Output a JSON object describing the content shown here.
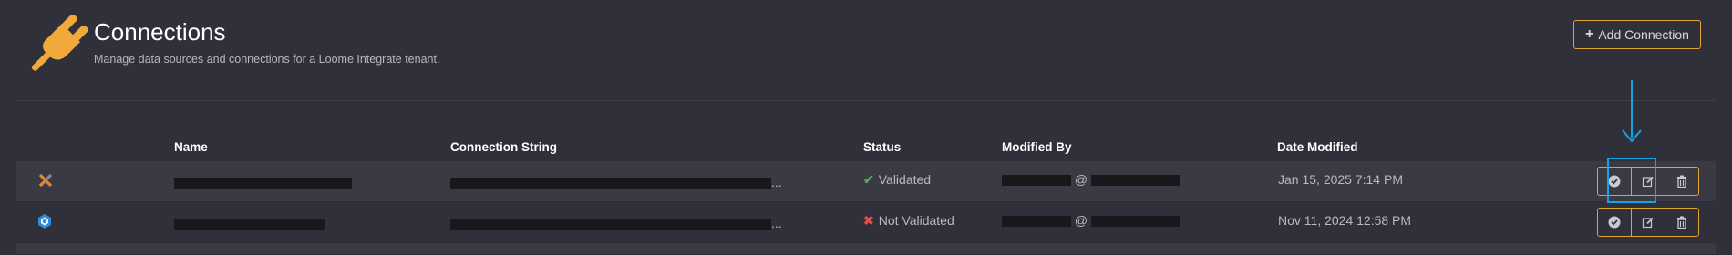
{
  "header": {
    "title": "Connections",
    "subtitle": "Manage data sources and connections for a Loome Integrate tenant.",
    "icon": "plug-icon"
  },
  "toolbar": {
    "add_label": "Add Connection"
  },
  "table": {
    "columns": [
      "Name",
      "Connection String",
      "Status",
      "Modified By",
      "Date Modified"
    ],
    "rows": [
      {
        "type_icon": "x-shaped-connector-icon",
        "status": "Validated",
        "status_icon": "check-icon",
        "modified_by_sep": "@",
        "conn_ellipsis": "...",
        "date_modified": "Jan 15, 2025 7:14 PM"
      },
      {
        "type_icon": "hexagon-connector-icon",
        "status": "Not Validated",
        "status_icon": "x-icon",
        "modified_by_sep": "@",
        "conn_ellipsis": "...",
        "date_modified": "Nov 11, 2024 12:58 PM"
      }
    ]
  },
  "colors": {
    "background": "#30303a",
    "row_alt": "#3a3a44",
    "accent": "#e0a431",
    "highlight": "#1aa1e6",
    "valid": "#4cae4c",
    "invalid": "#d9534f"
  }
}
